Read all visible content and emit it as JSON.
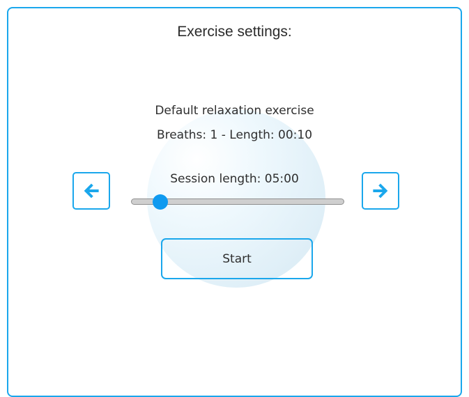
{
  "header": {
    "title": "Exercise settings:"
  },
  "exercise": {
    "name": "Default relaxation exercise",
    "details": "Breaths: 1 - Length: 00:10"
  },
  "session": {
    "label": "Session length: 05:00",
    "slider_fraction": 0.11
  },
  "navigation": {
    "prev_icon": "arrow-left-icon",
    "next_icon": "arrow-right-icon"
  },
  "actions": {
    "start_label": "Start"
  },
  "colors": {
    "accent": "#1aa7ec",
    "slider_thumb": "#0f9af0",
    "slider_track": "#cfcfcf",
    "text": "#2e2e2e"
  }
}
